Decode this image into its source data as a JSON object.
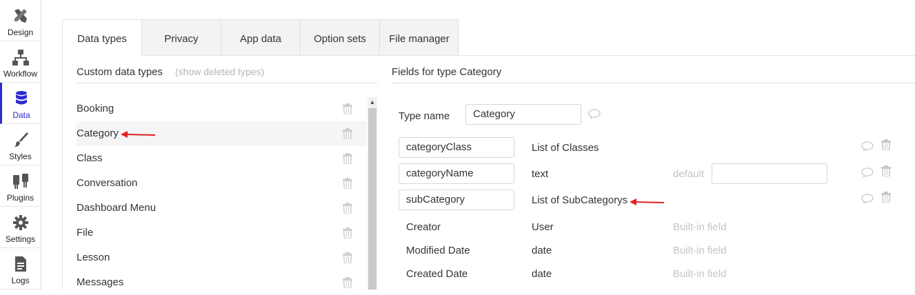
{
  "nav": {
    "items": [
      {
        "label": "Design",
        "icon": "design-icon",
        "active": false
      },
      {
        "label": "Workflow",
        "icon": "workflow-icon",
        "active": false
      },
      {
        "label": "Data",
        "icon": "database-icon",
        "active": true
      },
      {
        "label": "Styles",
        "icon": "brush-icon",
        "active": false
      },
      {
        "label": "Plugins",
        "icon": "plug-icon",
        "active": false
      },
      {
        "label": "Settings",
        "icon": "gear-icon",
        "active": false
      },
      {
        "label": "Logs",
        "icon": "document-icon",
        "active": false
      }
    ]
  },
  "tabs": [
    {
      "label": "Data types",
      "active": true
    },
    {
      "label": "Privacy",
      "active": false
    },
    {
      "label": "App data",
      "active": false
    },
    {
      "label": "Option sets",
      "active": false
    },
    {
      "label": "File manager",
      "active": false
    }
  ],
  "left": {
    "title": "Custom data types",
    "show_deleted": "(show deleted types)",
    "types": [
      "Booking",
      "Category",
      "Class",
      "Conversation",
      "Dashboard Menu",
      "File",
      "Lesson",
      "Messages"
    ],
    "selected": "Category"
  },
  "right": {
    "title": "Fields for type Category",
    "type_name_label": "Type name",
    "type_name_value": "Category",
    "fields": [
      {
        "name": "categoryClass",
        "type": "List of Classes"
      },
      {
        "name": "categoryName",
        "type": "text",
        "default_label": "default",
        "default_value": ""
      },
      {
        "name": "subCategory",
        "type": "List of SubCategorys"
      }
    ],
    "builtin": [
      {
        "name": "Creator",
        "type": "User",
        "note": "Built-in field"
      },
      {
        "name": "Modified Date",
        "type": "date",
        "note": "Built-in field"
      },
      {
        "name": "Created Date",
        "type": "date",
        "note": "Built-in field"
      }
    ]
  },
  "colors": {
    "accent": "#2b2bd0",
    "arrow": "#e02020",
    "icon_gray": "#555555"
  }
}
